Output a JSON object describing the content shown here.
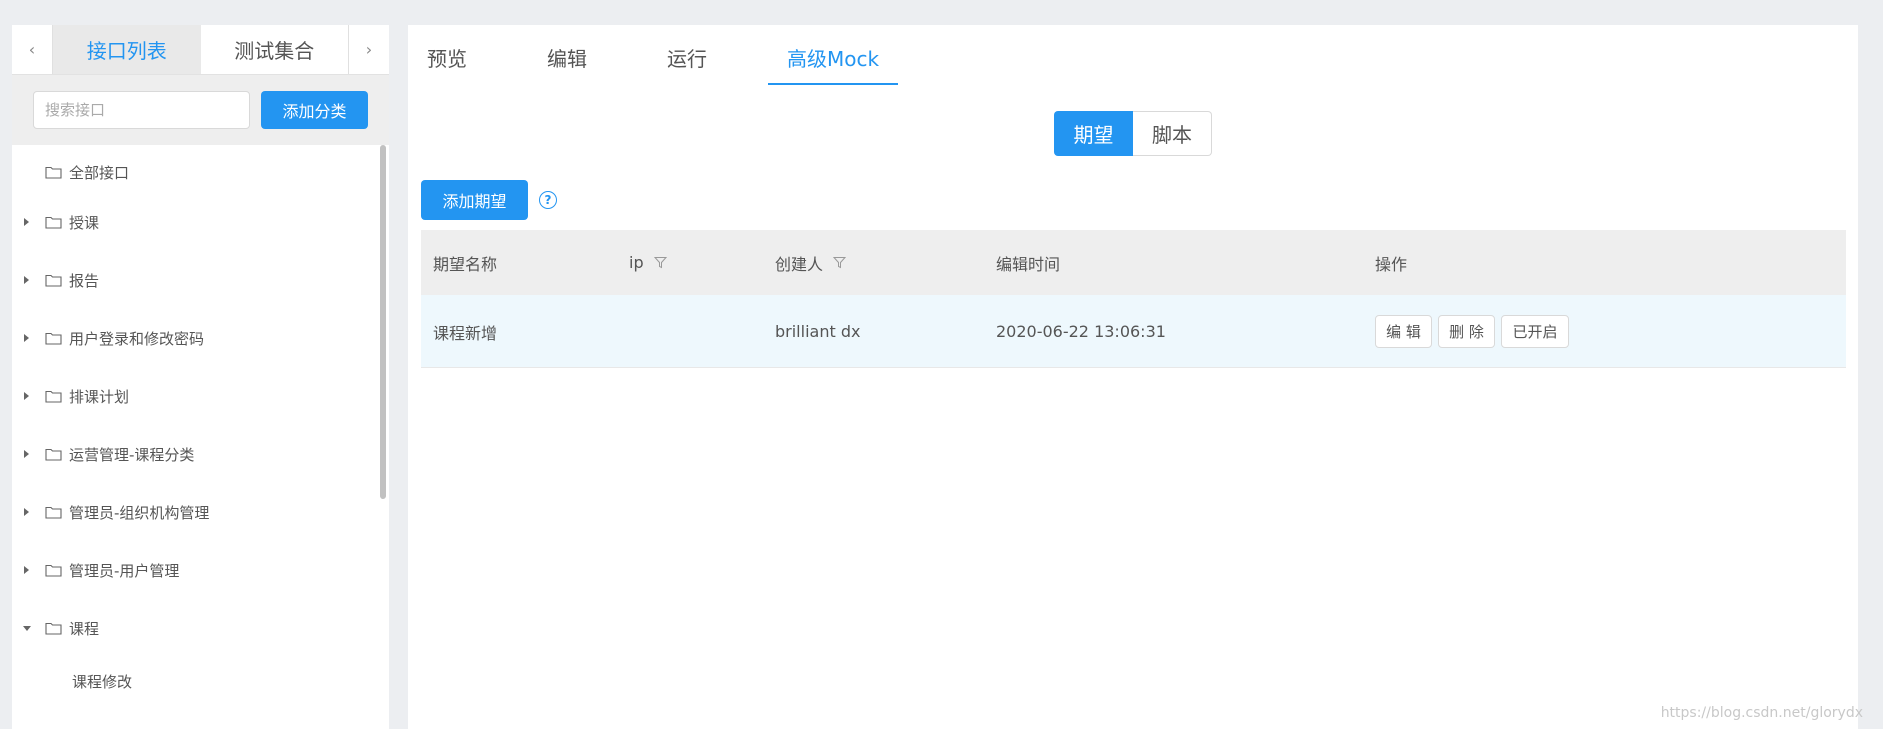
{
  "left_panel": {
    "tabs": [
      {
        "label": "接口列表",
        "active": true
      },
      {
        "label": "测试集合",
        "active": false
      }
    ],
    "prev_arrow": "‹",
    "next_arrow": "›",
    "search": {
      "placeholder": "搜索接口",
      "value": ""
    },
    "add_category_label": "添加分类",
    "tree": [
      {
        "label": "全部接口",
        "expandable": false,
        "expanded": false
      },
      {
        "label": "授课",
        "expandable": true,
        "expanded": false
      },
      {
        "label": "报告",
        "expandable": true,
        "expanded": false
      },
      {
        "label": "用户登录和修改密码",
        "expandable": true,
        "expanded": false
      },
      {
        "label": "排课计划",
        "expandable": true,
        "expanded": false
      },
      {
        "label": "运营管理-课程分类",
        "expandable": true,
        "expanded": false
      },
      {
        "label": "管理员-组织机构管理",
        "expandable": true,
        "expanded": false
      },
      {
        "label": "管理员-用户管理",
        "expandable": true,
        "expanded": false
      },
      {
        "label": "课程",
        "expandable": true,
        "expanded": true,
        "children": [
          "课程修改"
        ]
      }
    ]
  },
  "main": {
    "tabs": [
      {
        "label": "预览",
        "active": false
      },
      {
        "label": "编辑",
        "active": false
      },
      {
        "label": "运行",
        "active": false
      },
      {
        "label": "高级Mock",
        "active": true
      }
    ],
    "segment": [
      {
        "label": "期望",
        "active": true
      },
      {
        "label": "脚本",
        "active": false
      }
    ],
    "add_expectation_label": "添加期望",
    "help_icon_glyph": "?",
    "table": {
      "columns": [
        "期望名称",
        "ip",
        "创建人",
        "编辑时间",
        "操作"
      ],
      "rows": [
        {
          "name": "课程新增",
          "ip": "",
          "creator": "brilliant dx",
          "edit_time": "2020-06-22 13:06:31",
          "actions": [
            "编 辑",
            "删 除",
            "已开启"
          ]
        }
      ]
    }
  },
  "watermark": "https://blog.csdn.net/glorydx",
  "colors": {
    "accent": "#2395f1",
    "row_highlight": "#eef8fd",
    "header_bg": "#eeeeee"
  }
}
